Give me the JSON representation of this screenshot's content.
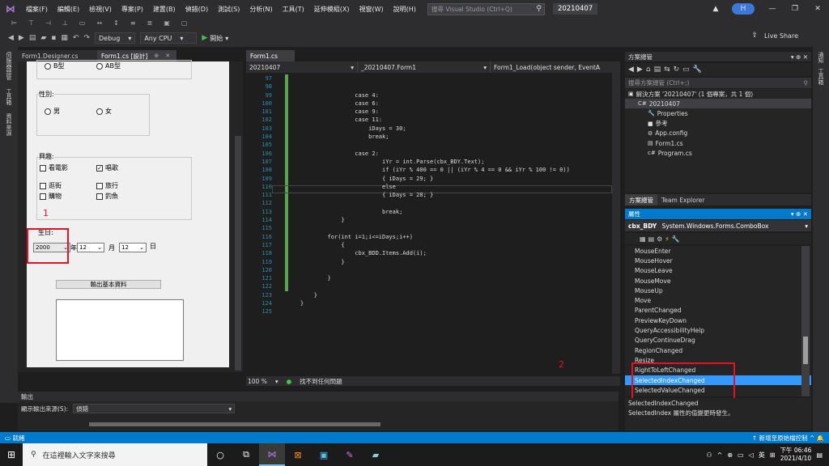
{
  "menubar": {
    "items": [
      "檔案(F)",
      "編輯(E)",
      "檢視(V)",
      "專案(P)",
      "建置(B)",
      "偵錯(D)",
      "測試(S)",
      "分析(N)",
      "工具(T)",
      "延伸模組(X)",
      "視窗(W)",
      "說明(H)"
    ],
    "search_placeholder": "搜尋 Visual Studio (Ctrl+Q)",
    "solution_name": "20210407",
    "avatar_initial": "H",
    "window_controls": [
      "—",
      "❐",
      "✕"
    ]
  },
  "toolbar": {
    "config": "Debug",
    "platform": "Any CPU",
    "start_label": "開始",
    "live_share": "Live Share"
  },
  "left_strip": [
    "伺服器總管",
    "工具箱",
    "資料來源"
  ],
  "designer": {
    "tabs": [
      {
        "label": "Form1.Designer.cs",
        "active": false
      },
      {
        "label": "Form1.cs [設計]",
        "active": true
      }
    ],
    "form": {
      "blood_options": [
        "B型",
        "AB型"
      ],
      "gender_label": "性別:",
      "gender_options": [
        "男",
        "女"
      ],
      "hobby_label": "興趣:",
      "hobbies": [
        {
          "label": "看電影",
          "checked": false
        },
        {
          "label": "唱歌",
          "checked": true
        },
        {
          "label": "逛街",
          "checked": false
        },
        {
          "label": "旅行",
          "checked": false
        },
        {
          "label": "購物",
          "checked": false
        },
        {
          "label": "釣魚",
          "checked": false
        }
      ],
      "birthday_label": "生日:",
      "year_value": "2000",
      "year_suffix": "年",
      "month_value": "12",
      "month_suffix": "月",
      "day_value": "12",
      "day_suffix": "日",
      "output_button": "輸出基本資料"
    },
    "annotation_1": "1"
  },
  "code_editor": {
    "tab": "Form1.cs",
    "nav_project": "20210407",
    "nav_class": "_20210407.Form1",
    "nav_member": "Form1_Load(object sender, EventA",
    "lines": [
      {
        "n": "97",
        "t": ""
      },
      {
        "n": "98",
        "t": ""
      },
      {
        "n": "99",
        "t": "                    case 4:"
      },
      {
        "n": "100",
        "t": "                    case 6:"
      },
      {
        "n": "101",
        "t": "                    case 9:"
      },
      {
        "n": "102",
        "t": "                    case 11:"
      },
      {
        "n": "103",
        "t": "                        iDays = 30;"
      },
      {
        "n": "104",
        "t": "                        break;"
      },
      {
        "n": "105",
        "t": ""
      },
      {
        "n": "106",
        "t": "                    case 2:"
      },
      {
        "n": "107",
        "t": "                            iYr = int.Parse(cbx_BDY.Text);"
      },
      {
        "n": "108",
        "t": "                            if (iYr % 400 == 0 || (iYr % 4 == 0 && iYr % 100 != 0))"
      },
      {
        "n": "109",
        "t": "                            { iDays = 29; }"
      },
      {
        "n": "110",
        "t": "                            else"
      },
      {
        "n": "111",
        "t": "                            { iDays = 28; }"
      },
      {
        "n": "112",
        "t": ""
      },
      {
        "n": "113",
        "t": "                            break;"
      },
      {
        "n": "114",
        "t": "                }"
      },
      {
        "n": "115",
        "t": ""
      },
      {
        "n": "116",
        "t": "            for(int i=1;i<=iDays;i++)"
      },
      {
        "n": "117",
        "t": "                {"
      },
      {
        "n": "118",
        "t": "                    cbx_BDD.Items.Add(i);"
      },
      {
        "n": "119",
        "t": "                }"
      },
      {
        "n": "120",
        "t": ""
      },
      {
        "n": "121",
        "t": "            }"
      },
      {
        "n": "122",
        "t": ""
      },
      {
        "n": "123",
        "t": "        }"
      },
      {
        "n": "124",
        "t": "    }"
      },
      {
        "n": "125",
        "t": ""
      }
    ],
    "zoom": "100 %",
    "issues": "找不到任何問題",
    "annotation_2": "2"
  },
  "output": {
    "title": "輸出",
    "source_label": "顯示輸出來源(S):",
    "source_value": "偵錯"
  },
  "solution_explorer": {
    "title": "方案總管",
    "search_placeholder": "搜尋方案總管 (Ctrl+;)",
    "items": [
      {
        "label": "解決方案 '20210407' (1 個專案，共 1 個)",
        "indent": 0,
        "icon": "▣"
      },
      {
        "label": "20210407",
        "indent": 1,
        "icon": "C#",
        "selected": true
      },
      {
        "label": "Properties",
        "indent": 2,
        "icon": "🔧"
      },
      {
        "label": "參考",
        "indent": 2,
        "icon": "■"
      },
      {
        "label": "App.config",
        "indent": 2,
        "icon": "⚙"
      },
      {
        "label": "Form1.cs",
        "indent": 2,
        "icon": "▤"
      },
      {
        "label": "Program.cs",
        "indent": 2,
        "icon": "c#"
      }
    ],
    "tabs": [
      "方案總管",
      "Team Explorer"
    ]
  },
  "properties": {
    "title": "屬性",
    "object_name": "cbx_BDY",
    "object_type": "System.Windows.Forms.ComboBox",
    "events": [
      "MouseEnter",
      "MouseHover",
      "MouseLeave",
      "MouseMove",
      "MouseUp",
      "Move",
      "ParentChanged",
      "PreviewKeyDown",
      "QueryAccessibilityHelp",
      "QueryContinueDrag",
      "RegionChanged",
      "Resize",
      "RightToLeftChanged",
      "SelectedIndexChanged",
      "SelectedValueChanged"
    ],
    "selected_event": "SelectedIndexChanged",
    "desc_title": "SelectedIndexChanged",
    "desc_text": "SelectedIndex 屬性的值變更時發生。"
  },
  "right_strip": [
    "通知",
    "工具箱"
  ],
  "statusbar": {
    "left": "就緒",
    "right": "新增至原始檔控制"
  },
  "taskbar": {
    "search_placeholder": "在這裡輸入文字來搜尋",
    "lang": "英",
    "time": "下午 06:46",
    "date": "2021/4/10"
  },
  "colors": {
    "accent": "#007acc",
    "annotation_red": "#e81123",
    "selected_event_bg": "#3399ff"
  }
}
